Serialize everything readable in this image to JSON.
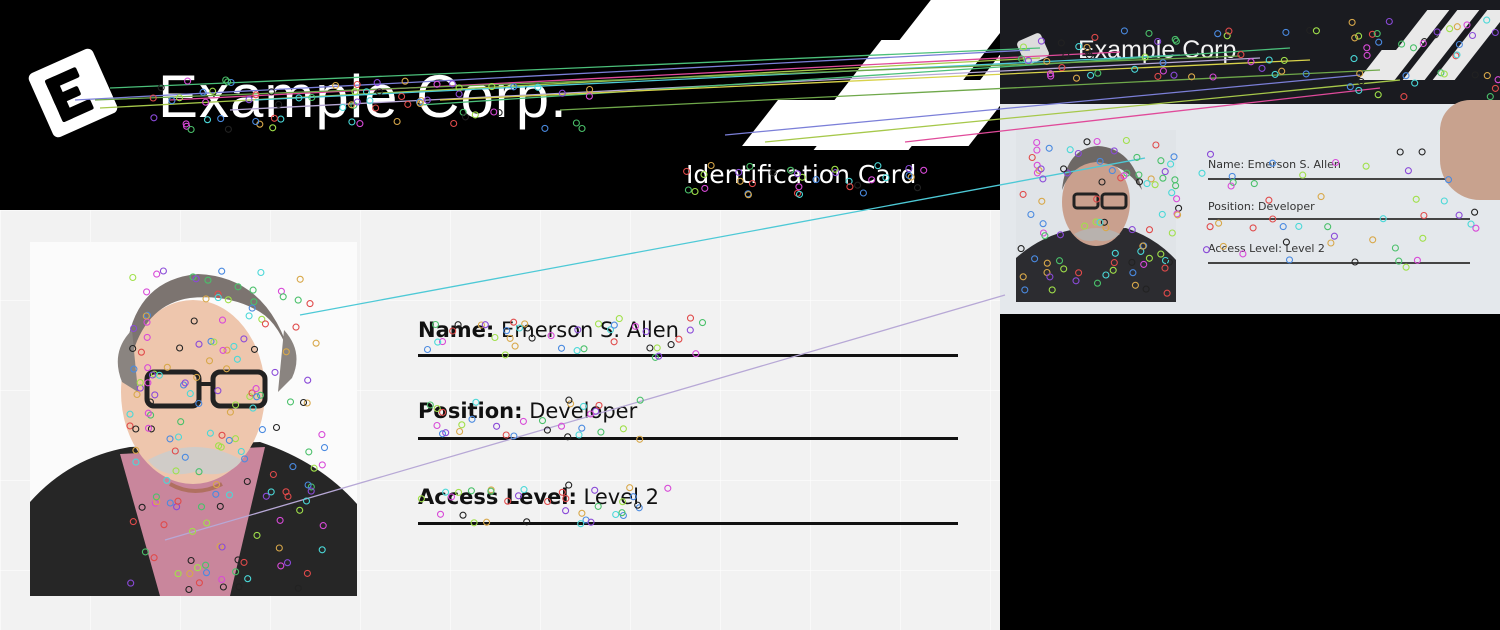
{
  "card": {
    "company": "Example Corp.",
    "card_type": "Identification Card",
    "fields": [
      {
        "label": "Name:",
        "value": "Emerson S. Allen"
      },
      {
        "label": "Position:",
        "value": "Developer"
      },
      {
        "label": "Access Level:",
        "value": "Level 2"
      }
    ]
  },
  "capture": {
    "company": "Example Corp",
    "fields": [
      {
        "label": "Name: Emerson S. Allen"
      },
      {
        "label": "Position: Developer"
      },
      {
        "label": "Access Level: Level 2"
      }
    ]
  },
  "colors": {
    "header": "#000000",
    "body": "#f2f2f2",
    "match_lines": [
      "#7b7fd8",
      "#a6c84a",
      "#e04a9a",
      "#4dc9d6",
      "#b7a8d6",
      "#4bbf7a",
      "#6fa84a",
      "#d8d24a"
    ],
    "keypoints": [
      "#e04a4a",
      "#4a8ae0",
      "#4ac06a",
      "#d84ad8",
      "#d8a84a",
      "#4ad8d8",
      "#8a4ad8",
      "#222222",
      "#a0e04a"
    ]
  }
}
